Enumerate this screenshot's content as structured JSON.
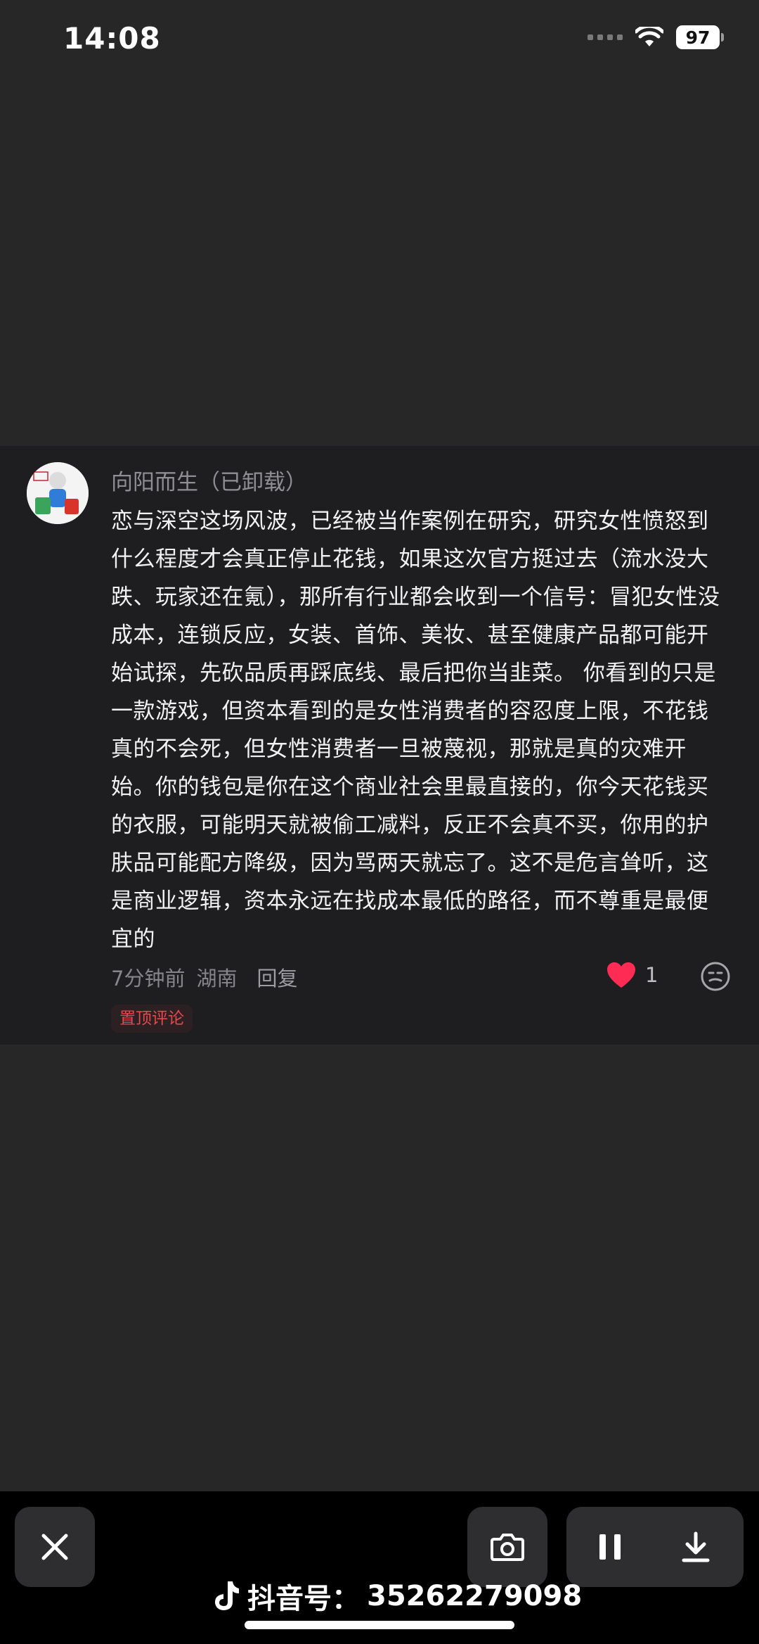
{
  "status_bar": {
    "time": "14:08",
    "battery": "97"
  },
  "comment": {
    "author": "向阳而生（已卸载）",
    "text": "恋与深空这场风波，已经被当作案例在研究，研究女性愤怒到什么程度才会真正停止花钱，如果这次官方挺过去（流水没大跌、玩家还在氪），那所有行业都会收到一个信号：冒犯女性没成本，连锁反应，女装、首饰、美妆、甚至健康产品都可能开始试探，先砍品质再踩底线、最后把你当韭菜。 你看到的只是一款游戏，但资本看到的是女性消费者的容忍度上限，不花钱真的不会死，但女性消费者一旦被蔑视，那就是真的灾难开始。你的钱包是你在这个商业社会里最直接的，你今天花钱买的衣服，可能明天就被偷工减料，反正不会真不买，你用的护肤品可能配方降级，因为骂两天就忘了。这不是危言耸听，这是商业逻辑，资本永远在找成本最低的路径，而不尊重是最便宜的",
    "time_ago": "7分钟前",
    "location": "湖南",
    "reply_label": "回复",
    "like_count": "1",
    "pinned_label": "置顶评论",
    "like_color": "#fe2c55"
  },
  "watermark": {
    "label": "抖音号：",
    "id": "35262279098"
  },
  "icons": {
    "close": "close-icon",
    "camera": "camera-icon",
    "pause": "pause-icon",
    "download": "download-icon",
    "wifi": "wifi-icon",
    "heart": "heart-icon",
    "emoji": "emoji-icon",
    "logo": "tiktok-logo-icon"
  }
}
